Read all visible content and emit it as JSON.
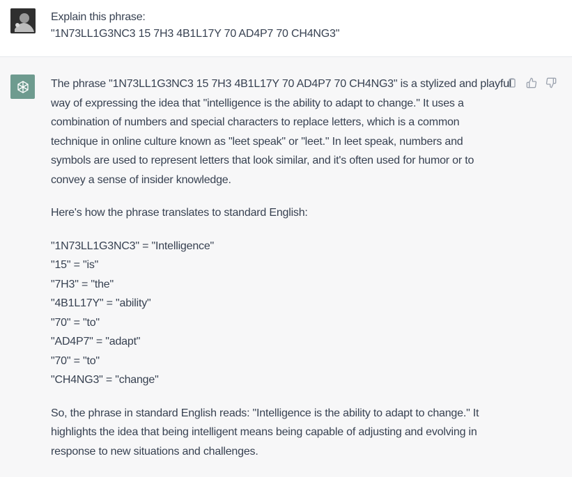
{
  "user_message": {
    "lines": [
      "Explain this phrase:",
      "\"1N73LL1G3NC3 15 7H3 4B1L17Y 70 AD4P7 70 CH4NG3\""
    ]
  },
  "assistant_message": {
    "intro_lines": [
      "The phrase \"1N73LL1G3NC3 15 7H3 4B1L17Y 70 AD4P7 70 CH4NG3\" is a stylized and playful",
      "way of expressing the idea that \"intelligence is the ability to adapt to change.\" It uses a",
      "combination of numbers and special characters to replace letters, which is a common",
      "technique in online culture known as \"leet speak\" or \"leet.\" In leet speak, numbers and",
      "symbols are used to represent letters that look similar, and it's often used for humor or to",
      "convey a sense of insider knowledge."
    ],
    "translation_intro": "Here's how the phrase translates to standard English:",
    "translations": [
      "\"1N73LL1G3NC3\" = \"Intelligence\"",
      "\"15\" = \"is\"",
      "\"7H3\" = \"the\"",
      "\"4B1L17Y\" = \"ability\"",
      "\"70\" = \"to\"",
      "\"AD4P7\" = \"adapt\"",
      "\"70\" = \"to\"",
      "\"CH4NG3\" = \"change\""
    ],
    "conclusion_lines": [
      "So, the phrase in standard English reads: \"Intelligence is the ability to adapt to change.\" It",
      "highlights the idea that being intelligent means being capable of adjusting and evolving in",
      "response to new situations and challenges."
    ]
  },
  "icons": {
    "user_avatar": "user-avatar-icon",
    "assistant_avatar": "openai-logo-icon",
    "copy": "clipboard-icon",
    "thumbs_up": "thumbs-up-icon",
    "thumbs_down": "thumbs-down-icon"
  },
  "colors": {
    "assistant_bg": "#f7f7f8",
    "assistant_avatar_bg": "#6e9b8f",
    "text": "#374151"
  }
}
